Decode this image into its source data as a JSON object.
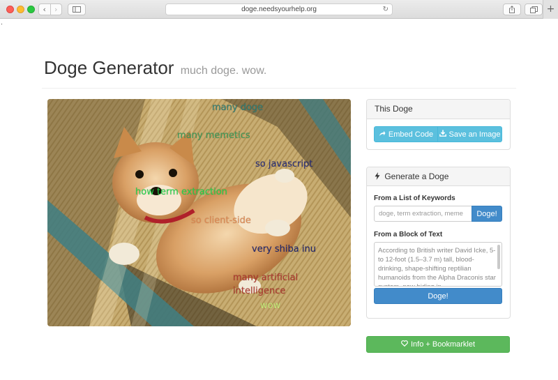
{
  "browser": {
    "url": "doge.needsyourhelp.org",
    "new_tab_label": "+"
  },
  "header": {
    "title": "Doge Generator",
    "subtitle": "much doge. wow."
  },
  "doge_image": {
    "phrases": [
      {
        "text": "many doge",
        "color": "#2f7f78"
      },
      {
        "text": "many memetics",
        "color": "#3d9c5a"
      },
      {
        "text": "so javascript",
        "color": "#2a2f7a"
      },
      {
        "text": "how term extraction",
        "color": "#22d64a"
      },
      {
        "text": "so client-side",
        "color": "#e08a52"
      },
      {
        "text": "very shiba inu",
        "color": "#22276f"
      },
      {
        "text": "many artificial",
        "color": "#b0382e"
      },
      {
        "text": "intelligence",
        "color": "#b0382e"
      },
      {
        "text": "wow",
        "color": "#c8ef7a"
      }
    ]
  },
  "this_doge": {
    "heading": "This Doge",
    "embed_label": "Embed Code",
    "save_label": "Save an Image"
  },
  "generate": {
    "heading": "Generate a Doge",
    "keywords_label": "From a List of Keywords",
    "keywords_placeholder": "doge, term extraction, meme",
    "keywords_button": "Doge!",
    "text_label": "From a Block of Text",
    "text_value": "According to British writer David Icke, 5- to 12-foot (1.5–3.7 m) tall, blood-drinking, shape-shifting reptilian humanoids from the Alpha Draconis star system, now hiding in",
    "text_button": "Doge!"
  },
  "footer": {
    "info_label": "Info + Bookmarklet"
  },
  "colors": {
    "info": "#5bc0de",
    "primary": "#428bca",
    "success": "#5cb85c"
  }
}
